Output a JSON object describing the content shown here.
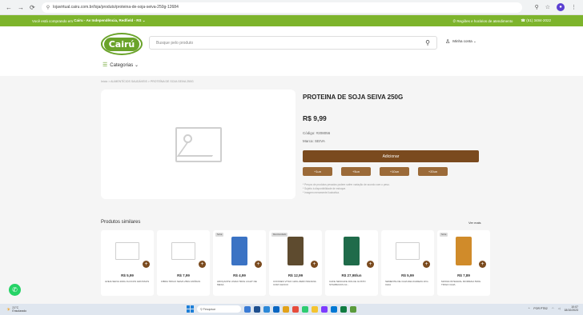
{
  "browser": {
    "url": "lojavirtual.cairu.com.br/loja/produto/proteina-de-soja-seiva-250g-12684",
    "back": "←",
    "forward": "→",
    "reload": "⟳"
  },
  "topbar": {
    "location_prefix": "Você está comprando em",
    "location_store": "Cairu - Av Independência, Redfield - RS ⌄",
    "policy": "Regiões e horários de atendimento",
    "phone": "(51) 3484-2022"
  },
  "header": {
    "logo": "Cairú",
    "search_placeholder": "Busque pelo produto",
    "account": "Minha conta ⌄",
    "categories": "Categorias ⌄"
  },
  "breadcrumb": "Início > ALIMENTÍCIOS SAUDÁVEIS > PROTEÍNA DE SOJA SEIVA 250G",
  "product": {
    "title": "PROTEINA DE SOJA SEIVA 250G",
    "price": "R$ 9,99",
    "code": "Código: #208056",
    "brand": "Marca: SEIVA",
    "add_label": "Adicionar",
    "qty_buttons": [
      "+1un",
      "+5un",
      "+10un",
      "+20un"
    ],
    "notes": [
      "* Preços de produtos pesados podem sofrer variação de acordo com o peso.",
      "* Sujeito à disponibilidade de estoque.",
      "* Imagem meramente ilustrativa."
    ]
  },
  "similar": {
    "title": "Produtos similares",
    "see_more": "Ver mais",
    "items": [
      {
        "price": "R$ 5,99",
        "name": "AVEIA SEIVA 200G FLOCOS GROSSOS",
        "tag": "",
        "image": "placeholder",
        "color": ""
      },
      {
        "price": "R$ 7,99",
        "name": "FIBRA TRIGO SEIVA 250G MOÍDAS",
        "tag": "",
        "image": "placeholder",
        "color": ""
      },
      {
        "price": "R$ 4,99",
        "name": "ADOÇANTE UNIAO 500G LIGHT DE MESA",
        "tag": "Seiva",
        "image": "package",
        "color": "#3b73c4"
      },
      {
        "price": "R$ 12,99",
        "name": "COOKIES VITAO 120G ZERO BANANA COM CHOCO",
        "tag": "Recomendado",
        "image": "package",
        "color": "#5e4b2f"
      },
      {
        "price": "R$ 27,98/un",
        "name": "CAFE NESCAFE DOLCE GUSTO STARBUCKS 10...",
        "tag": "",
        "image": "package",
        "color": "#1f6b4a"
      },
      {
        "price": "R$ 5,99",
        "name": "SEMENTE DE CHIA DELICADEZA 1KG CHIA",
        "tag": "",
        "image": "placeholder",
        "color": ""
      },
      {
        "price": "R$ 7,89",
        "name": "MASSA INTEGRAL MORMAIA 500G TRIGO CHIA",
        "tag": "Seiva",
        "image": "package",
        "color": "#d08b2a"
      }
    ]
  },
  "taskbar": {
    "temp": "21°C",
    "weather": "Ensolarado",
    "search": "Pesquisar",
    "lang": "POR PTB2",
    "time": "10:07",
    "date": "18/10/2023"
  }
}
